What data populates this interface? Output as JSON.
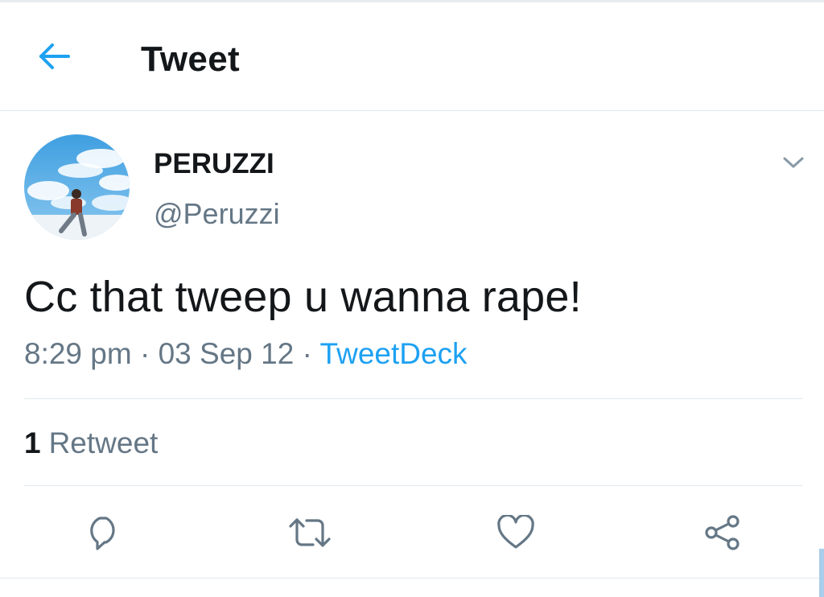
{
  "header": {
    "title": "Tweet",
    "back_icon": "arrow-left-icon"
  },
  "tweet": {
    "author": {
      "display_name": "PERUZZI",
      "handle": "@Peruzzi"
    },
    "text": "Cc that tweep u wanna rape!",
    "time": "8:29 pm",
    "date": "03 Sep 12",
    "separator": "·",
    "source": "TweetDeck",
    "retweet_count": "1",
    "retweet_label": "Retweet"
  },
  "actions": [
    {
      "icon": "reply-icon"
    },
    {
      "icon": "retweet-icon"
    },
    {
      "icon": "like-icon"
    },
    {
      "icon": "share-icon"
    }
  ],
  "colors": {
    "accent": "#1da1f2",
    "text_primary": "#14171a",
    "text_secondary": "#657786",
    "divider": "#e1e8ed",
    "icon": "#657786"
  }
}
